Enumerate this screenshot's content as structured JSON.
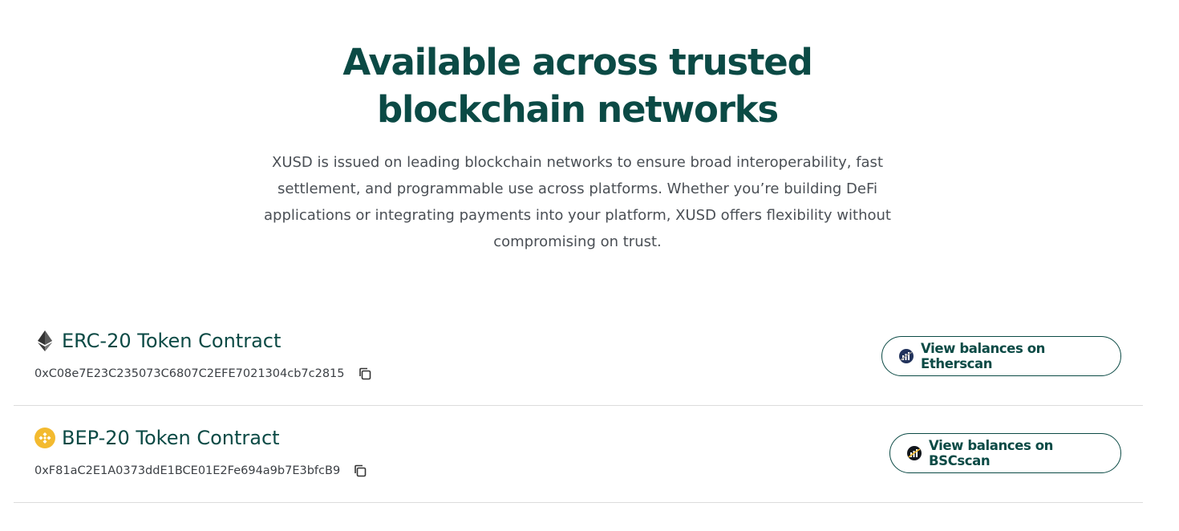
{
  "hero": {
    "title": "Available across trusted blockchain networks",
    "description": "XUSD is issued on leading blockchain networks to ensure broad interoperability, fast settlement, and programmable use across platforms. Whether you’re building DeFi applications or integrating payments into your platform, XUSD offers flexibility without compromising on trust."
  },
  "contracts": [
    {
      "icon": "ethereum-icon",
      "title": "ERC-20 Token Contract",
      "address": "0xC08e7E23C235073C6807C2EFE7021304cb7c2815",
      "button_label": "View balances on Etherscan",
      "button_icon": "etherscan-icon"
    },
    {
      "icon": "bnb-icon",
      "title": "BEP-20 Token Contract",
      "address": "0xF81aC2E1A0373ddE1BCE01E2Fe694a9b7E3bfcB9",
      "button_label": "View balances on BSCscan",
      "button_icon": "bscscan-icon"
    }
  ],
  "colors": {
    "primary": "#0b4a45",
    "body_text": "#4a4f55",
    "divider": "#dcdcdc",
    "bnb_yellow": "#f3ba2f"
  }
}
